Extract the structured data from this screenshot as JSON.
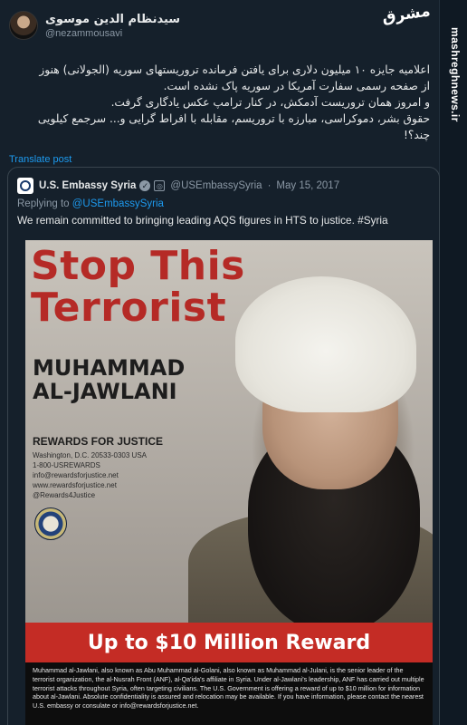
{
  "tweet": {
    "display_name": "سیدنظام الدین موسوی",
    "handle": "@nezammousavi",
    "body_lines": [
      "اعلامیه جایزه ۱۰ میلیون دلاری برای یافتن فرمانده تروریستهای سوریه (الجولانی) هنوز",
      "از صفحه رسمی سفارت آمریکا در سوریه پاک نشده است.",
      "و امروز همان تروریست آدمکش، در کنار ترامپ عکس یادگاری گرفت.",
      "حقوق بشر، دموکراسی، مبارزه با تروریسم، مقابله با افراط گرایی و... سرجمع کیلویی",
      "چند؟!"
    ],
    "translate_label": "Translate post"
  },
  "watermark": {
    "logo_text": "مشرق",
    "site": "mashreghnews.ir"
  },
  "quote": {
    "name": "U.S. Embassy Syria",
    "handle": "@USEmbassySyria",
    "separator": "·",
    "date": "May 15, 2017",
    "replying_prefix": "Replying to",
    "replying_handle": "@USEmbassySyria",
    "text": "We remain committed to bringing leading AQS figures in HTS to justice. #Syria"
  },
  "poster": {
    "title_line1": "Stop This",
    "title_line2": "Terrorist",
    "name_line1": "MUHAMMAD",
    "name_line2": "AL-JAWLANI",
    "org": "REWARDS FOR JUSTICE",
    "contact_lines": [
      "Washington, D.C. 20533-0303 USA",
      "1-800-USREWARDS",
      "info@rewardsforjustice.net",
      "www.rewardsforjustice.net",
      "@Rewards4Justice"
    ],
    "reward": "Up to $10 Million Reward",
    "fine_print": "Muhammad al-Jawlani, also known as Abu Muhammad al-Golani, also known as Muhammad al-Julani, is the senior leader of the terrorist organization, the al-Nusrah Front (ANF), al-Qa'ida's affiliate in Syria. Under al-Jawlani's leadership, ANF has carried out multiple terrorist attacks throughout Syria, often targeting civilians. The U.S. Government is offering a reward of up to $10 million for information about al-Jawlani. Absolute confidentiality is assured and relocation may be available. If you have information, please contact the nearest U.S. embassy or consulate or info@rewardsforjustice.net."
  }
}
